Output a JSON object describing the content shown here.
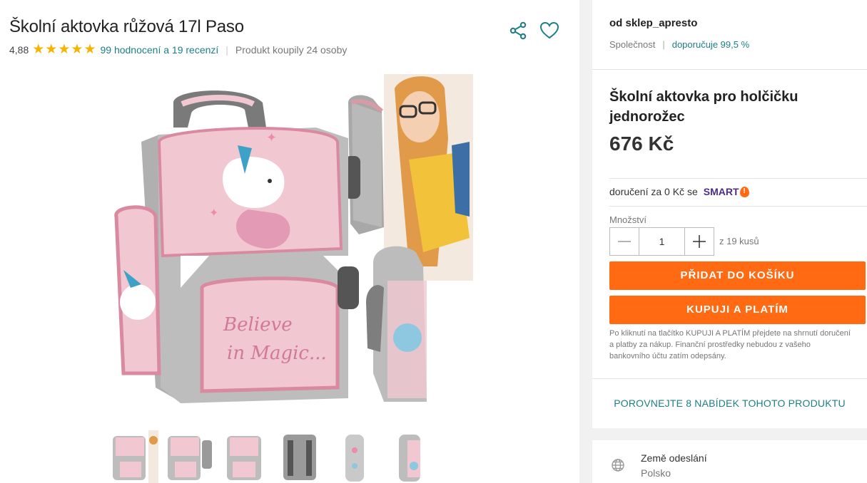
{
  "product": {
    "title": "Školní aktovka růžová 17l Paso",
    "rating": "4,88",
    "stars": 5,
    "reviews_link": "99 hodnocení a 19 recenzí",
    "separator": "|",
    "bought": "Produkt koupily 24 osoby"
  },
  "icons": {
    "share": "share-icon",
    "favorite": "heart-icon",
    "globe": "globe-icon"
  },
  "seller": {
    "name": "od sklep_apresto",
    "type": "Společnost",
    "separator": "|",
    "recommend": "doporučuje 99,5 %"
  },
  "offer": {
    "name": "Školní aktovka pro holčičku jednorožec",
    "price": "676 Kč",
    "delivery": "doručení za 0 Kč se",
    "smart": "SMART",
    "quantity_label": "Množství",
    "quantity": "1",
    "stock": "z 19 kusů",
    "add_to_cart": "PŘIDAT DO KOŠÍKU",
    "buy_now": "KUPUJI A PLATÍM",
    "note": "Po kliknutí na tlačítko KUPUJI A PLATÍM přejdete na shrnutí doručení a platby za nákup. Finanční prostředky nebudou z vašeho bankovního účtu zatím odepsány.",
    "compare": "POROVNEJTE 8 NABÍDEK TOHOTO PRODUKTU"
  },
  "shipping": {
    "origin_label": "Země odeslání",
    "origin_value": "Polsko"
  },
  "colors": {
    "accent": "#1d7f85",
    "cta": "#ff6a13",
    "star": "#f5b400",
    "smart": "#4b2e83"
  },
  "thumbnails": 6
}
